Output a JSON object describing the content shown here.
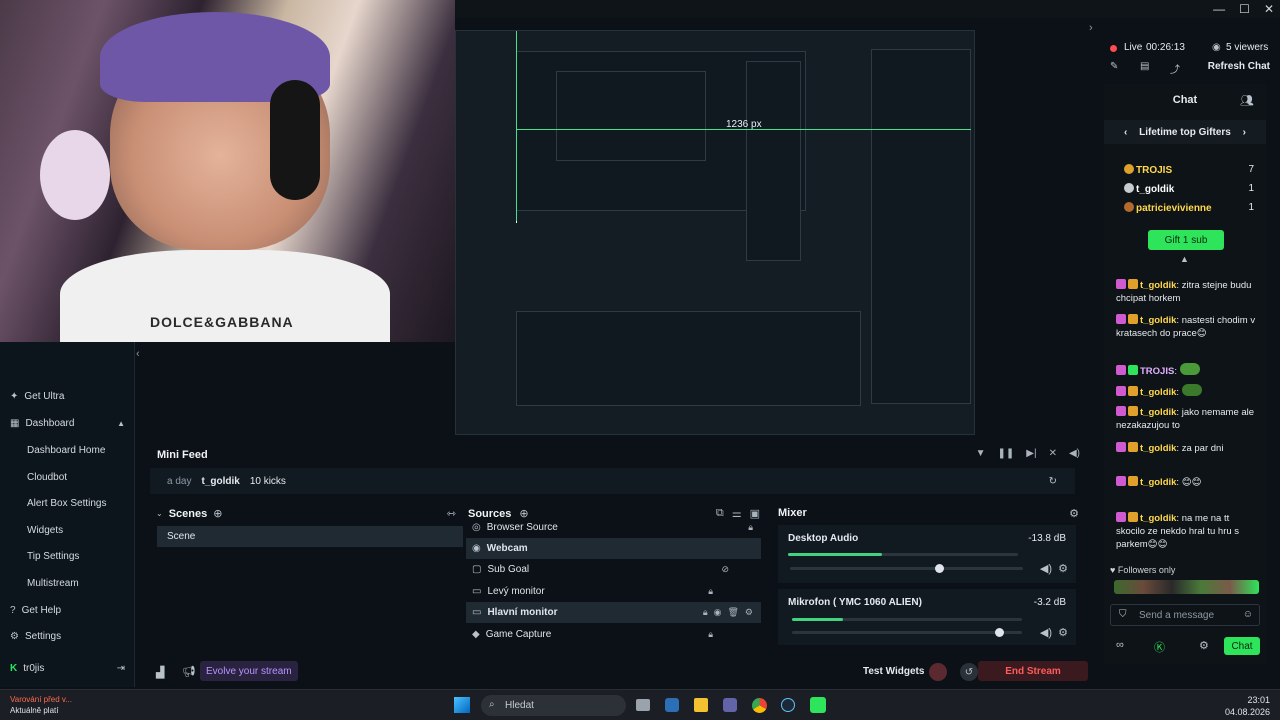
{
  "stream": {
    "live_label": "Live",
    "live_time": "00:26:13",
    "viewers": "5 viewers",
    "refresh_chat": "Refresh Chat"
  },
  "preview": {
    "dimension_label": "1236 px"
  },
  "webcam": {
    "shirt_text": "DOLCE&GABBANA"
  },
  "nav": {
    "items": [
      {
        "label": "Get Ultra",
        "icon": "ultra-icon"
      },
      {
        "label": "Dashboard",
        "icon": "dashboard-icon"
      },
      {
        "label": "Dashboard Home"
      },
      {
        "label": "Cloudbot"
      },
      {
        "label": "Alert Box Settings"
      },
      {
        "label": "Widgets"
      },
      {
        "label": "Tip Settings"
      },
      {
        "label": "Multistream"
      },
      {
        "label": "Get Help",
        "icon": "help-icon"
      },
      {
        "label": "Settings",
        "icon": "gear-icon"
      },
      {
        "label": "tr0jis",
        "icon": "kick-icon"
      }
    ]
  },
  "mini_feed": {
    "title": "Mini Feed",
    "event": {
      "time": "a day",
      "user": "t_goldik",
      "text": "10 kicks"
    }
  },
  "scenes": {
    "title": "Scenes",
    "items": [
      "Scene"
    ]
  },
  "sources": {
    "title": "Sources",
    "items": [
      "Browser Source",
      "Webcam",
      "Sub Goal",
      "Levý monitor",
      "Hlavní monitor",
      "Game Capture"
    ]
  },
  "mixer": {
    "title": "Mixer",
    "tracks": [
      {
        "name": "Desktop Audio",
        "db": "-13.8 dB",
        "level": 0.41,
        "volume": 0.64
      },
      {
        "name": "Mikrofon ( YMC 1060 ALIEN)",
        "db": "-3.2 dB",
        "level": 0.22,
        "volume": 0.9
      }
    ]
  },
  "bottom": {
    "evolve": "Evolve your stream",
    "test_widgets": "Test Widgets",
    "end_stream": "End Stream"
  },
  "chat": {
    "title": "Chat",
    "gifters_title": "Lifetime top Gifters",
    "gifters": [
      {
        "name": "TROJIS",
        "count": "7",
        "color": "#ffd84d"
      },
      {
        "name": "t_goldik",
        "count": "1",
        "color": "#ffffff"
      },
      {
        "name": "patricievivienne",
        "count": "1",
        "color": "#ffd84d"
      }
    ],
    "gift_button": "Gift 1 sub",
    "messages": [
      {
        "user": "t_goldik",
        "text": "zitra stejne budu chcipat horkem"
      },
      {
        "user": "t_goldik",
        "text": "nastesti chodim v kratasech do prace😊"
      },
      {
        "user": "TROJIS",
        "text": ""
      },
      {
        "user": "t_goldik",
        "text": ""
      },
      {
        "user": "t_goldik",
        "text": "jako nemame ale nezakazujou to"
      },
      {
        "user": "t_goldik",
        "text": "za par dni"
      },
      {
        "user": "t_goldik",
        "text": "😊😊"
      },
      {
        "user": "t_goldik",
        "text": "na me na tt skocilo ze nekdo hral tu hru s parkem😊😊"
      }
    ],
    "followers_only": "Followers only",
    "input_placeholder": "Send a message",
    "send_button": "Chat"
  },
  "taskbar": {
    "warning_line1": "Varování před v...",
    "warning_line2": "Aktuálně platí",
    "search_placeholder": "Hledat",
    "time": "23:01",
    "date": "04.08.2026"
  },
  "colors": {
    "accent_green": "#2ee45a",
    "meter_green": "#43d27f",
    "end_stream_red": "#ff5b5b"
  }
}
